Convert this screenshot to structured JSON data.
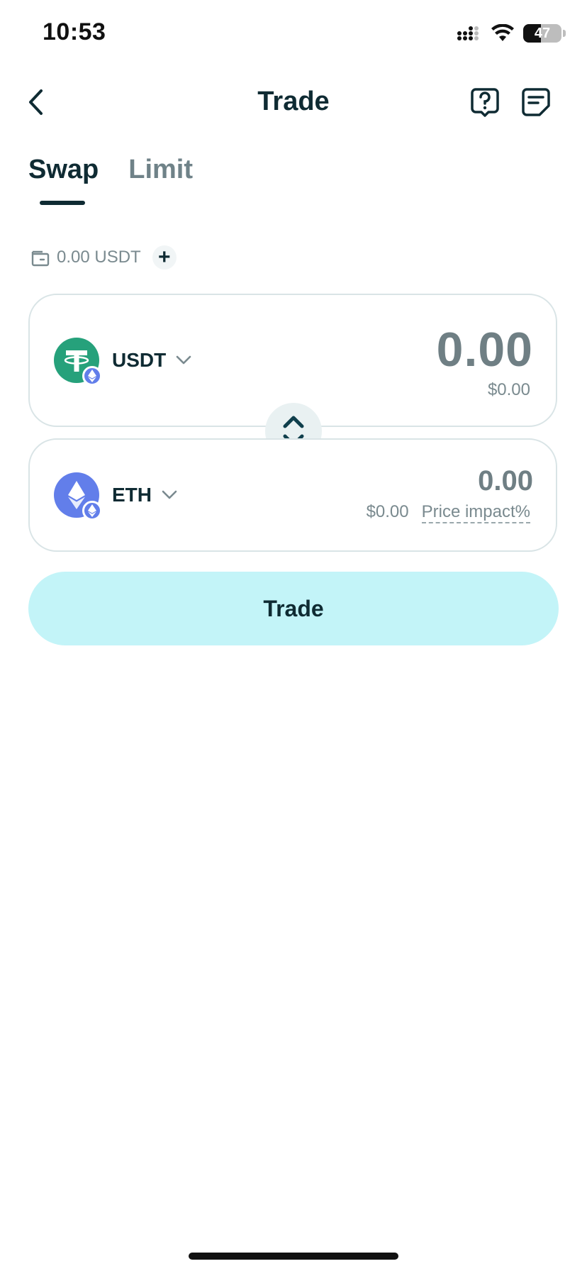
{
  "status_bar": {
    "time": "10:53",
    "battery": "47",
    "battery_level": 0.47
  },
  "header": {
    "title": "Trade",
    "back_icon": "chevron-left-icon",
    "help_icon": "help-chat-icon",
    "history_icon": "document-list-icon"
  },
  "tabs": [
    {
      "label": "Swap",
      "active": true
    },
    {
      "label": "Limit",
      "active": false
    }
  ],
  "balance": {
    "text": "0.00 USDT",
    "wallet_icon": "wallet-icon",
    "add_label": "+"
  },
  "from": {
    "symbol": "USDT",
    "amount": "0.00",
    "fiat": "$0.00",
    "logo_color": "#26a17b",
    "network_badge": "ethereum-icon"
  },
  "to": {
    "symbol": "ETH",
    "amount": "0.00",
    "fiat": "$0.00",
    "price_impact_label": "Price impact%",
    "logo_color": "#627eea",
    "network_badge": "ethereum-icon"
  },
  "switch_icon": "swap-vertical-icon",
  "trade_button": {
    "label": "Trade",
    "background": "#c3f4f8"
  },
  "colors": {
    "primary_text": "#0f2b33",
    "muted_text": "#7a8a8f",
    "border": "#d9e4e6"
  }
}
